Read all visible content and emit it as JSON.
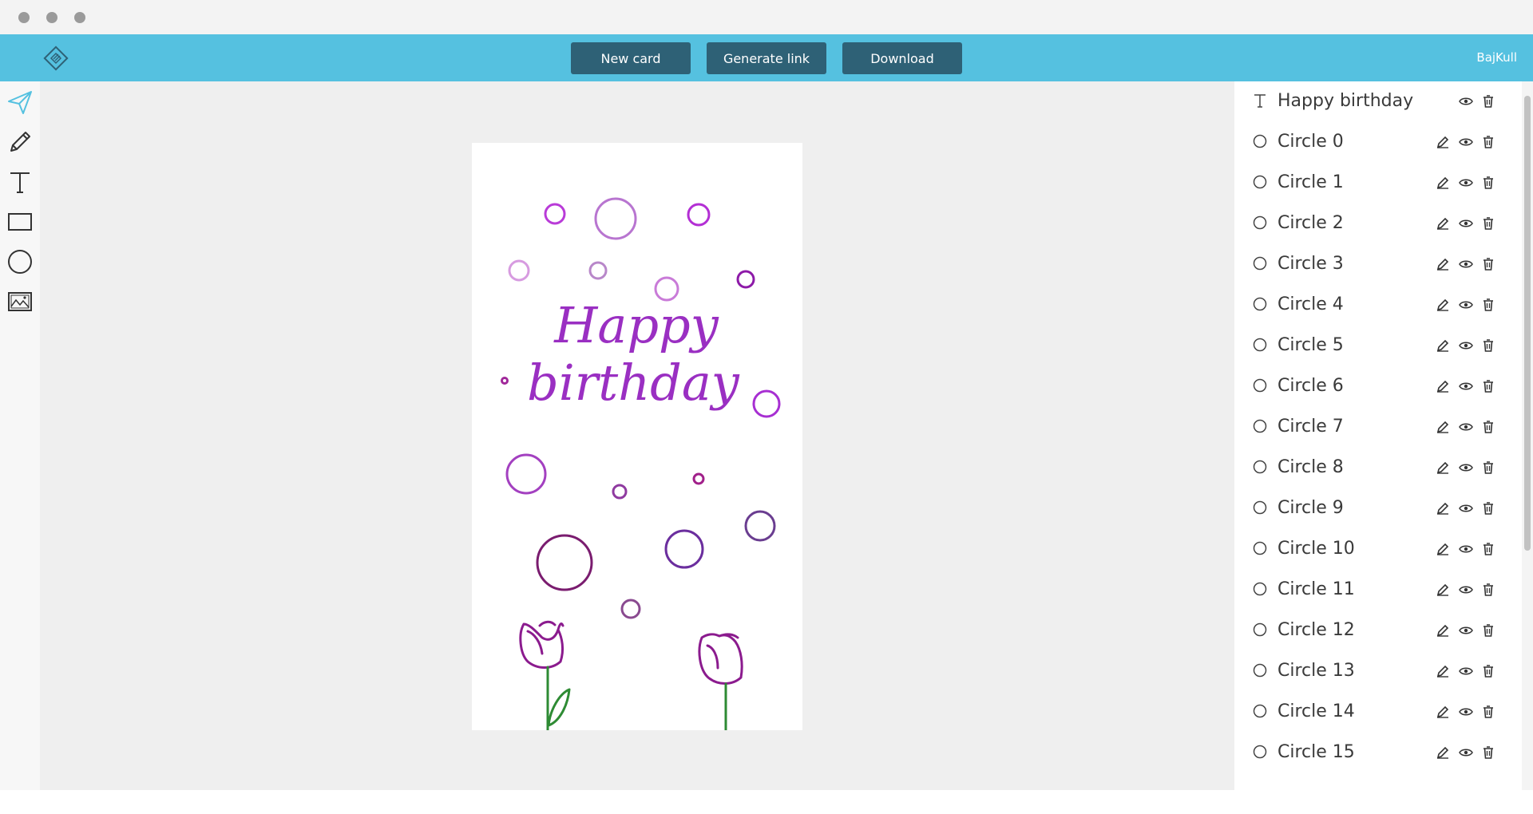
{
  "window": {
    "controls": [
      "close",
      "minimize",
      "maximize"
    ]
  },
  "header": {
    "new_card_label": "New card",
    "generate_link_label": "Generate link",
    "download_label": "Download",
    "username": "BajKull",
    "accent_color": "#55c1e0",
    "button_color": "#2e6176"
  },
  "tools": [
    {
      "icon": "send-icon",
      "active": true
    },
    {
      "icon": "pencil-icon",
      "active": false
    },
    {
      "icon": "text-icon",
      "active": false
    },
    {
      "icon": "rectangle-icon",
      "active": false
    },
    {
      "icon": "circle-icon",
      "active": false
    },
    {
      "icon": "image-icon",
      "active": false
    }
  ],
  "card": {
    "text_line1": "Happy",
    "text_line2": "birthday",
    "text_color": "#9a2fc2"
  },
  "layers": [
    {
      "type": "text",
      "name": "Happy birthday",
      "editable": false
    },
    {
      "type": "circle",
      "name": "Circle 0",
      "editable": true
    },
    {
      "type": "circle",
      "name": "Circle 1",
      "editable": true
    },
    {
      "type": "circle",
      "name": "Circle 2",
      "editable": true
    },
    {
      "type": "circle",
      "name": "Circle 3",
      "editable": true
    },
    {
      "type": "circle",
      "name": "Circle 4",
      "editable": true
    },
    {
      "type": "circle",
      "name": "Circle 5",
      "editable": true
    },
    {
      "type": "circle",
      "name": "Circle 6",
      "editable": true
    },
    {
      "type": "circle",
      "name": "Circle 7",
      "editable": true
    },
    {
      "type": "circle",
      "name": "Circle 8",
      "editable": true
    },
    {
      "type": "circle",
      "name": "Circle 9",
      "editable": true
    },
    {
      "type": "circle",
      "name": "Circle 10",
      "editable": true
    },
    {
      "type": "circle",
      "name": "Circle 11",
      "editable": true
    },
    {
      "type": "circle",
      "name": "Circle 12",
      "editable": true
    },
    {
      "type": "circle",
      "name": "Circle 13",
      "editable": true
    },
    {
      "type": "circle",
      "name": "Circle 14",
      "editable": true
    },
    {
      "type": "circle",
      "name": "Circle 15",
      "editable": true
    }
  ]
}
